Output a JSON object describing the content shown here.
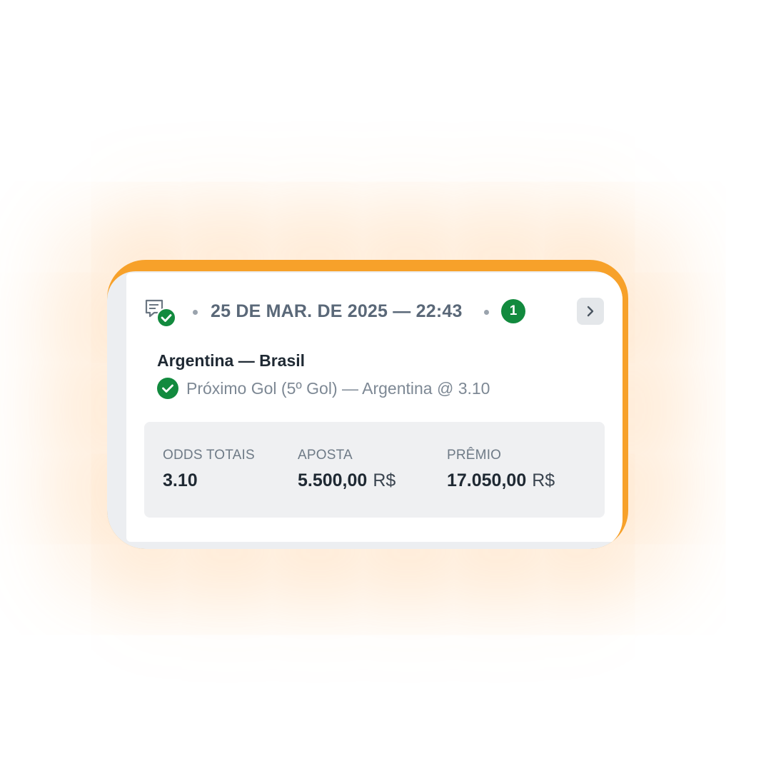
{
  "colors": {
    "accent": "#f7a12a",
    "success": "#128a3e",
    "summary_bg": "#eff0f2"
  },
  "bet_card": {
    "status_icon": "ticket-check-icon",
    "datetime": "25 DE MAR. DE 2025 — 22:43",
    "selections_count": "1",
    "details_icon": "chevron-right-icon"
  },
  "event": {
    "match": "Argentina — Brasil",
    "selection_icon": "check-circle-icon",
    "selection": "Próximo Gol (5º Gol) — Argentina @ 3.10"
  },
  "summary": {
    "odds_label": "ODDS TOTAIS",
    "odds_value": "3.10",
    "stake_label": "APOSTA",
    "stake_value": "5.500,00",
    "stake_currency": "R$",
    "prize_label": "PRÊMIO",
    "prize_value": "17.050,00",
    "prize_currency": "R$"
  }
}
